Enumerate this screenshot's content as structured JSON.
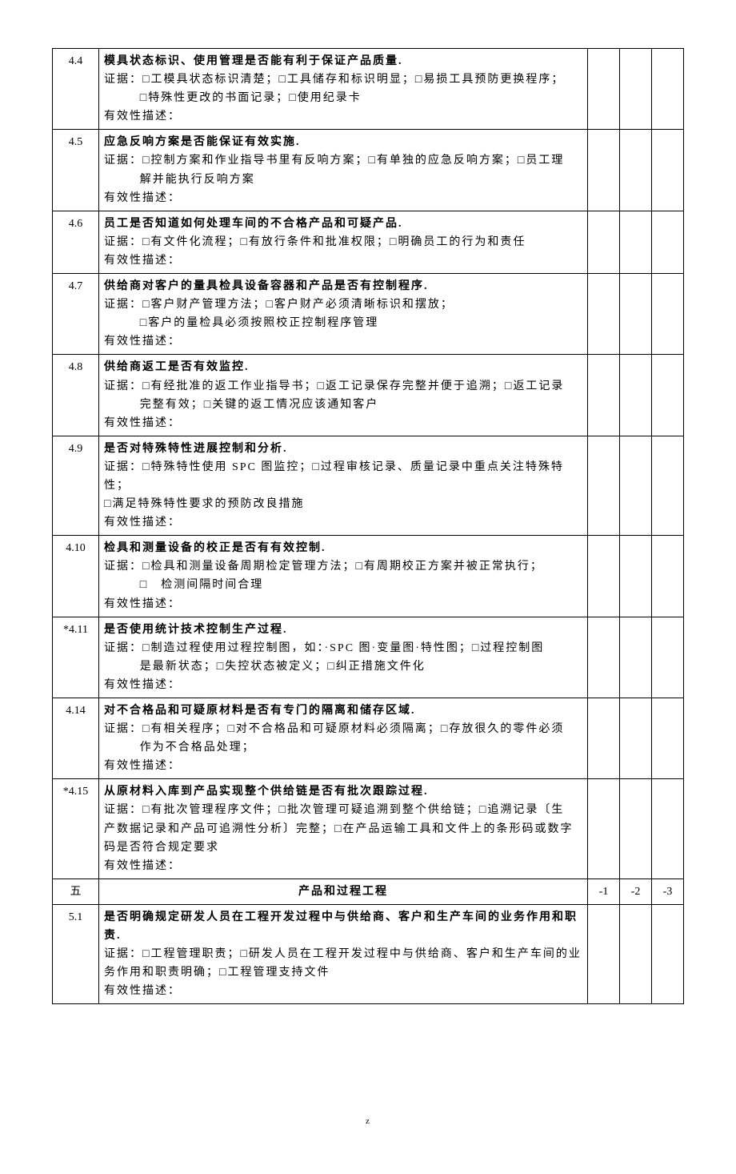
{
  "rows": [
    {
      "num": "4.4",
      "title": "模具状态标识、使用管理是否能有利于保证产品质量.",
      "evidence": "证据：□工模具状态标识清楚；□工具储存和标识明显；□易损工具预防更换程序；",
      "indent": "□特殊性更改的书面记录；□使用纪录卡",
      "desc": "有效性描述："
    },
    {
      "num": "4.5",
      "title": "应急反响方案是否能保证有效实施.",
      "evidence": "证据：□控制方案和作业指导书里有反响方案；□有单独的应急反响方案；□员工理",
      "indent": "解并能执行反响方案",
      "desc": "有效性描述："
    },
    {
      "num": "4.6",
      "title": "员工是否知道如何处理车间的不合格产品和可疑产品.",
      "evidence": "证据：□有文件化流程；□有放行条件和批准权限；□明确员工的行为和责任",
      "indent": "",
      "desc": "有效性描述："
    },
    {
      "num": "4.7",
      "title": "供给商对客户的量具检具设备容器和产品是否有控制程序.",
      "evidence": "证据：□客户财产管理方法；□客户财产必须清晰标识和摆放；",
      "indent": "□客户的量检具必须按照校正控制程序管理",
      "desc": "有效性描述："
    },
    {
      "num": "4.8",
      "title": "供给商返工是否有效监控.",
      "evidence": "证据：□有经批准的返工作业指导书；□返工记录保存完整并便于追溯；□返工记录",
      "indent": "完整有效；□关键的返工情况应该通知客户",
      "desc": "有效性描述："
    },
    {
      "num": "4.9",
      "title": "是否对特殊特性进展控制和分析.",
      "evidence": "证据：□特殊特性使用 SPC 图监控；□过程审核记录、质量记录中重点关注特殊特性；",
      "evidence2": "□满足特殊特性要求的预防改良措施",
      "indent": "",
      "desc": "有效性描述："
    },
    {
      "num": "4.10",
      "title": "检具和测量设备的校正是否有有效控制.",
      "evidence": "证据：□检具和测量设备周期检定管理方法；□有周期校正方案并被正常执行；",
      "indent": "□　检测间隔时间合理",
      "desc": "有效性描述："
    },
    {
      "num": "*4.11",
      "title": "是否使用统计技术控制生产过程.",
      "evidence": "证据：□制造过程使用过程控制图，如：·SPC 图·变量图·特性图；□过程控制图",
      "indent": "是最新状态；□失控状态被定义；□纠正措施文件化",
      "desc": "有效性描述："
    },
    {
      "num": "4.14",
      "title": "对不合格品和可疑原材料是否有专门的隔离和储存区域.",
      "evidence": "证据：□有相关程序；□对不合格品和可疑原材料必须隔离；□存放很久的零件必须",
      "indent": "作为不合格品处理；",
      "desc": "有效性描述："
    },
    {
      "num": "*4.15",
      "title": "从原材料入库到产品实现整个供给链是否有批次跟踪过程.",
      "evidence": "证据：□有批次管理程序文件；□批次管理可疑追溯到整个供给链；□追溯记录〔生",
      "evidence2": "产数据记录和产品可追溯性分析〕完整；□在产品运输工具和文件上的条形码或数字",
      "evidence3": "码是否符合规定要求",
      "indent": "",
      "desc": "有效性描述："
    }
  ],
  "section": {
    "num": "五",
    "title": "产品和过程工程",
    "scores": [
      "-1",
      "-2",
      "-3"
    ]
  },
  "row51": {
    "num": "5.1",
    "title": "是否明确规定研发人员在工程开发过程中与供给商、客户和生产车间的业务作用和职责.",
    "evidence": "证据：□工程管理职责；□研发人员在工程开发过程中与供给商、客户和生产车间的业",
    "evidence2": "务作用和职责明确；□工程管理支持文件",
    "desc": "有效性描述："
  },
  "footer": "z"
}
